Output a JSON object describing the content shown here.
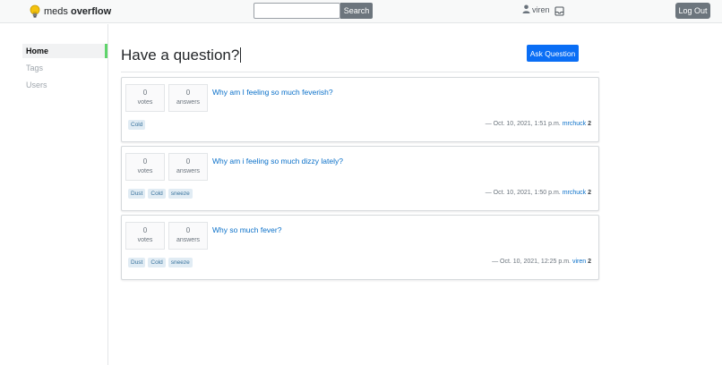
{
  "header": {
    "brand_prefix": "meds",
    "brand_bold": "overflow",
    "search_placeholder": "",
    "search_button": "Search",
    "username": "viren",
    "logout_label": "Log Out"
  },
  "sidebar": {
    "items": [
      {
        "label": "Home"
      },
      {
        "label": "Tags"
      },
      {
        "label": "Users"
      }
    ]
  },
  "main": {
    "title": "Have a question?",
    "ask_button": "Ask Question",
    "questions": [
      {
        "votes": "0",
        "votes_label": "votes",
        "answers": "0",
        "answers_label": "answers",
        "title": "Why am I feeling so much feverish?",
        "tags": [
          "Cold"
        ],
        "timestamp": "— Oct. 10, 2021, 1:51 p.m.",
        "author": "mrchuck",
        "reputation": "2"
      },
      {
        "votes": "0",
        "votes_label": "votes",
        "answers": "0",
        "answers_label": "answers",
        "title": "Why am i feeling so much dizzy lately?",
        "tags": [
          "Dust",
          "Cold",
          "sneeze"
        ],
        "timestamp": "— Oct. 10, 2021, 1:50 p.m.",
        "author": "mrchuck",
        "reputation": "2"
      },
      {
        "votes": "0",
        "votes_label": "votes",
        "answers": "0",
        "answers_label": "answers",
        "title": "Why so much fever?",
        "tags": [
          "Dust",
          "Cold",
          "sneeze"
        ],
        "timestamp": "— Oct. 10, 2021, 12:25 p.m.",
        "author": "viren",
        "reputation": "2"
      }
    ]
  },
  "icons": {
    "logo": "lightbulb-icon",
    "user": "user-icon",
    "inbox": "inbox-icon"
  },
  "colors": {
    "accent": "#0a6ef5",
    "active_marker": "#5fd46b",
    "link": "#0a70c9",
    "button_secondary": "#6c757d"
  }
}
